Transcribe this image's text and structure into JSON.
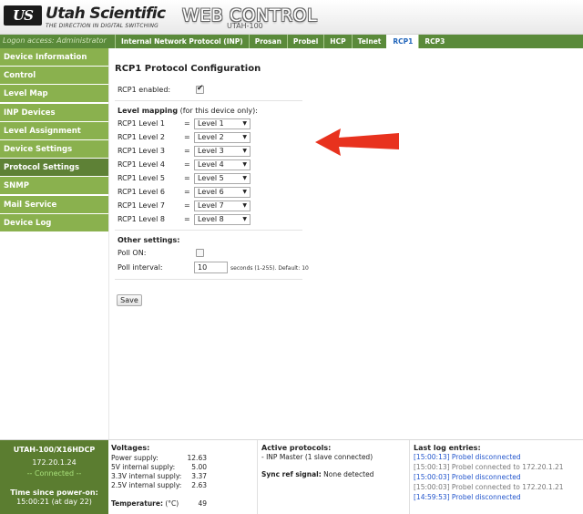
{
  "header": {
    "logo_text": "US",
    "brand": "Utah Scientific",
    "tagline": "THE DIRECTION IN DIGITAL SWITCHING",
    "title": "WEB CONTROL",
    "subtitle": "UTAH-100"
  },
  "tabbar": {
    "login": "Logon access: Administrator",
    "tabs": [
      "Internal Network Protocol (INP)",
      "Prosan",
      "Probel",
      "HCP",
      "Telnet",
      "RCP1",
      "RCP3"
    ],
    "active_tab": "RCP1"
  },
  "sidebar": {
    "items": [
      "Device Information",
      "Control",
      "Level Map",
      "INP Devices",
      "Level Assignment",
      "Device Settings",
      "Protocol Settings",
      "SNMP",
      "Mail Service",
      "Device Log"
    ],
    "active_item": "Protocol Settings"
  },
  "main": {
    "title": "RCP1 Protocol Configuration",
    "enabled_label": "RCP1 enabled:",
    "enabled_checked": true,
    "level_mapping_title": "Level mapping",
    "level_mapping_note": "(for this device only):",
    "levels": [
      {
        "label": "RCP1 Level 1",
        "value": "Level 1"
      },
      {
        "label": "RCP1 Level 2",
        "value": "Level 2"
      },
      {
        "label": "RCP1 Level 3",
        "value": "Level 3"
      },
      {
        "label": "RCP1 Level 4",
        "value": "Level 4"
      },
      {
        "label": "RCP1 Level 5",
        "value": "Level 5"
      },
      {
        "label": "RCP1 Level 6",
        "value": "Level 6"
      },
      {
        "label": "RCP1 Level 7",
        "value": "Level 7"
      },
      {
        "label": "RCP1 Level 8",
        "value": "Level 8"
      }
    ],
    "eq_sign": "=",
    "other_title": "Other settings:",
    "poll_on_label": "Poll ON:",
    "poll_on_checked": false,
    "poll_interval_label": "Poll interval:",
    "poll_interval_value": "10",
    "poll_interval_hint": "seconds (1-255). Default: 10",
    "save_label": "Save"
  },
  "footer": {
    "device_name": "UTAH-100/X16HDCP",
    "device_ip": "172.20.1.24",
    "device_status": "-- Connected --",
    "uptime_label": "Time since power-on:",
    "uptime": "15:00:21 (at day 22)",
    "voltages_title": "Voltages:",
    "voltages": [
      {
        "label": "Power supply:",
        "value": "12.63"
      },
      {
        "label": "5V internal supply:",
        "value": "5.00"
      },
      {
        "label": "3.3V internal supply:",
        "value": "3.37"
      },
      {
        "label": "2.5V internal supply:",
        "value": "2.63"
      }
    ],
    "temperature_label": "Temperature:",
    "temperature_unit": "(°C)",
    "temperature_value": "49",
    "protocols_title": "Active protocols:",
    "protocols_line": "- INP Master (1 slave connected)",
    "sync_label": "Sync ref signal:",
    "sync_value": "None detected",
    "log_title": "Last log entries:",
    "log_entries": [
      {
        "text": "[15:00:13] Probel disconnected",
        "style": "blue"
      },
      {
        "text": "[15:00:13] Probel connected to 172.20.1.21",
        "style": "gray"
      },
      {
        "text": "[15:00:03] Probel disconnected",
        "style": "blue"
      },
      {
        "text": "[15:00:03] Probel connected to 172.20.1.21",
        "style": "gray"
      },
      {
        "text": "[14:59:53] Probel disconnected",
        "style": "blue"
      }
    ]
  },
  "colors": {
    "sidebar_green": "#8ab14e",
    "sidebar_active": "#5e8136",
    "tabbar_green": "#5a8a3a",
    "footer_green": "#5b7d30",
    "active_tab_text": "#2266bb",
    "arrow_red": "#e8321e"
  }
}
